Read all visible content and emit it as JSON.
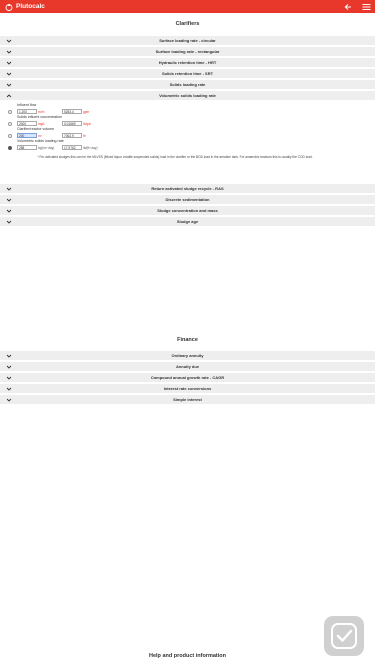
{
  "app": {
    "title": "Plutocalc"
  },
  "clarifiers": {
    "title": "Clarifiers",
    "rows": [
      {
        "label": "Surface loading rate - circular",
        "expanded": false
      },
      {
        "label": "Surface loading rate - rectangular",
        "expanded": false
      },
      {
        "label": "Hydraulic retention time - HRT",
        "expanded": false
      },
      {
        "label": "Solids retention time - SRT",
        "expanded": false
      },
      {
        "label": "Solids loading rate",
        "expanded": false
      },
      {
        "label": "Volumetric solids loading rate",
        "expanded": true
      }
    ],
    "vslr": {
      "influent_flow_label": "Influent flow",
      "influent_flow_value": "1,200",
      "influent_flow_unit": "m³/h",
      "influent_flow_value2": "5283.4",
      "influent_flow_unit2": "gpm",
      "solids_label": "Solids influent concentration",
      "solids_value": "2000",
      "solids_unit": "mg/L",
      "solids_value2": "0.01669",
      "solids_unit2": "lb/gal",
      "volume_label": "Clarifier/reactor volume",
      "volume_value": "200",
      "volume_unit": "m³",
      "volume_value2": "7062.9",
      "volume_unit2": "ft³",
      "result_label": "Volumetric solids loading rate",
      "result_value": "288",
      "result_unit": "kg/(m³·day)",
      "result_value2": "17.9762",
      "result_unit2": "lb/(ft³·day)",
      "note": "* For activated sludges this can be the MLVSS (Mixed liquor volatile suspended solids) load in the clarifier or the BOD load in the aeration tank. For anaerobic reactors this is usually the COD load."
    },
    "rows_after": [
      {
        "label": "Return activated sludge recycle - RAS"
      },
      {
        "label": "Discrete sedimentation"
      },
      {
        "label": "Sludge concentration and mass"
      },
      {
        "label": "Sludge age"
      }
    ]
  },
  "finance": {
    "title": "Finance",
    "rows": [
      {
        "label": "Ordinary annuity"
      },
      {
        "label": "Annuity due"
      },
      {
        "label": "Compound annual growth rate - CAGR"
      },
      {
        "label": "Interest rate conversions"
      },
      {
        "label": "Simple interest"
      }
    ]
  },
  "help": {
    "title": "Help and product information"
  },
  "colors": {
    "brand": "#e8372b",
    "row_bg": "#eeeeee"
  },
  "icons": {
    "logo": "flame-logo-icon",
    "back": "arrow-left-icon",
    "menu": "hamburger-menu-icon",
    "chevron_down": "chevron-down-icon",
    "chevron_up": "chevron-up-icon",
    "hero": "checkmark-app-icon"
  }
}
